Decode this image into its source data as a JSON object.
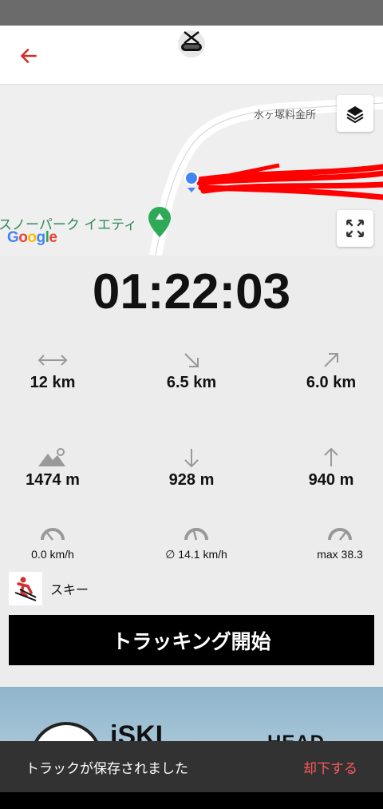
{
  "header": {
    "back_icon": "arrow-left-icon",
    "logo_icon": "ski-goggles-logo-icon",
    "accent_color": "#d32f2f"
  },
  "map": {
    "road_label": "水ヶ塚料金所",
    "poi_label": "スノーパーク イエティ",
    "attribution": "Google",
    "layers_icon": "layers-icon",
    "fullscreen_icon": "fullscreen-icon",
    "track_color": "#ff0000"
  },
  "tracking": {
    "elapsed_time": "01:22:03"
  },
  "stats": {
    "distance": {
      "icon": "horizontal-distance-icon",
      "value": "12 km"
    },
    "descent_distance": {
      "icon": "arrow-down-right-icon",
      "value": "6.5 km"
    },
    "ascent_distance": {
      "icon": "arrow-up-right-icon",
      "value": "6.0 km"
    },
    "altitude": {
      "icon": "mountain-pin-icon",
      "value": "1474 m"
    },
    "descent_height": {
      "icon": "arrow-down-icon",
      "value": "928 m"
    },
    "ascent_height": {
      "icon": "arrow-up-icon",
      "value": "940 m"
    },
    "current_speed": {
      "icon": "speedometer-icon",
      "value": "0.0 km/h"
    },
    "avg_speed": {
      "icon": "speedometer-icon",
      "value": "∅ 14.1 km/h"
    },
    "max_speed": {
      "icon": "speedometer-icon",
      "value": "max 38.3"
    }
  },
  "activity": {
    "icon": "skier-icon",
    "label": "スキー"
  },
  "start_button": {
    "label": "トラッキング開始"
  },
  "banner": {
    "brand1": "iSKI",
    "brand2": "HEAD"
  },
  "snackbar": {
    "message": "トラックが保存されました",
    "action": "却下する"
  }
}
